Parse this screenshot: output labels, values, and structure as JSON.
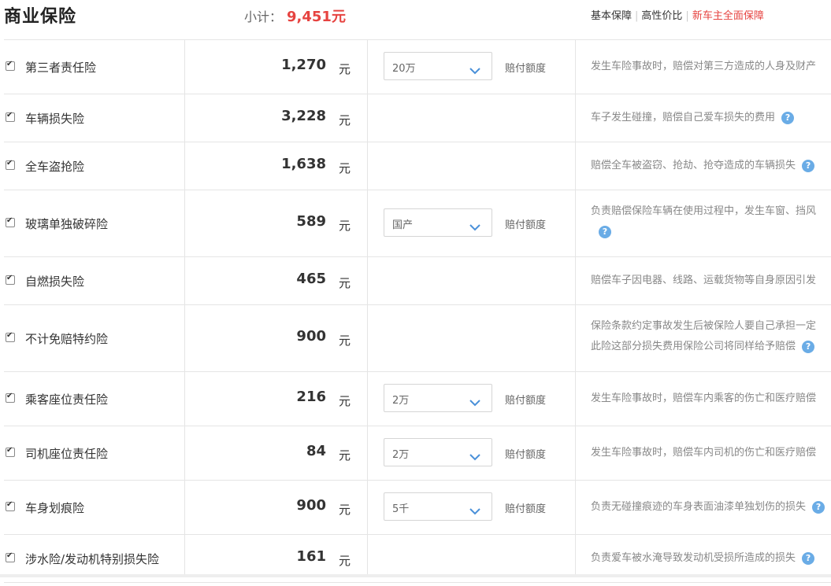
{
  "header": {
    "title": "商业保险",
    "subtotal_label": "小计：",
    "subtotal_value": "9,451元",
    "plans": [
      "基本保障",
      "高性价比",
      "新车主全面保障"
    ],
    "active_plan": "新车主全面保障"
  },
  "currency_unit": "元",
  "pay_label": "赔付额度",
  "colors": {
    "accent": "#e64340",
    "help_icon": "#6aace6",
    "border": "#e5e5e5"
  },
  "rows": [
    {
      "name": "第三者责任险",
      "price": "1,270",
      "select": "20万",
      "desc": "发生车险事故时，赔偿对第三方造成的人身及财产",
      "help": false
    },
    {
      "name": "车辆损失险",
      "price": "3,228",
      "select": null,
      "desc": "车子发生碰撞，赔偿自己爱车损失的费用",
      "help": true
    },
    {
      "name": "全车盗抢险",
      "price": "1,638",
      "select": null,
      "desc": "赔偿全车被盗窃、抢劫、抢夺造成的车辆损失",
      "help": true
    },
    {
      "name": "玻璃单独破碎险",
      "price": "589",
      "select": "国产",
      "desc": "负责赔偿保险车辆在使用过程中，发生车窗、挡风",
      "help": true
    },
    {
      "name": "自燃损失险",
      "price": "465",
      "select": null,
      "desc": "赔偿车子因电器、线路、运载货物等自身原因引发",
      "help": false
    },
    {
      "name": "不计免赔特约险",
      "price": "900",
      "select": null,
      "desc": "保险条款约定事故发生后被保险人要自己承担一定",
      "desc2": "此险这部分损失费用保险公司将同样给予赔偿",
      "help": true
    },
    {
      "name": "乘客座位责任险",
      "price": "216",
      "select": "2万",
      "desc": "发生车险事故时，赔偿车内乘客的伤亡和医疗赔偿",
      "help": false
    },
    {
      "name": "司机座位责任险",
      "price": "84",
      "select": "2万",
      "desc": "发生车险事故时，赔偿车内司机的伤亡和医疗赔偿",
      "help": false
    },
    {
      "name": "车身划痕险",
      "price": "900",
      "select": "5千",
      "desc": "负责无碰撞痕迹的车身表面油漆单独划伤的损失",
      "help": true
    },
    {
      "name": "涉水险/发动机特别损失险",
      "price": "161",
      "select": null,
      "desc": "负责爱车被水淹导致发动机受损所造成的损失",
      "help": true
    }
  ]
}
